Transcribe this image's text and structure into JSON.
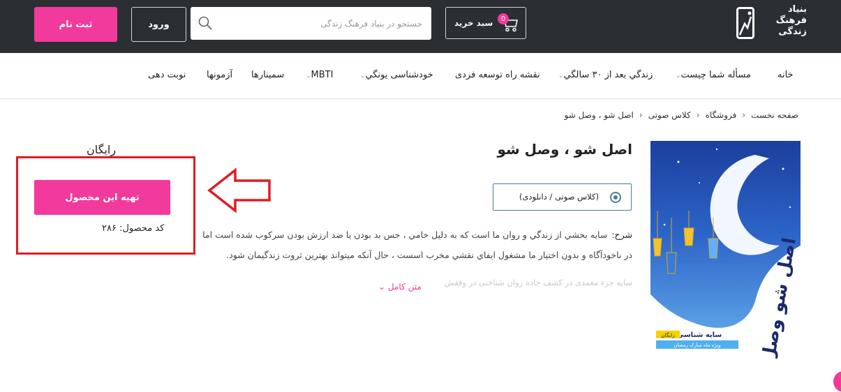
{
  "header": {
    "logo_lines": [
      "بنیاد",
      "فرهنگ",
      "زندگی"
    ],
    "signup_label": "ثبت نام",
    "login_label": "ورود",
    "search_placeholder": "جستجو در بنیاد فرهنگ زندگی",
    "cart_label": "سبد خرید",
    "cart_count": "0"
  },
  "nav": {
    "items": [
      {
        "label": "خانه"
      },
      {
        "label": "مسأله شما چیست",
        "dropdown": true
      },
      {
        "label": "زندگي بعد از ۳۰ سالگي",
        "dropdown": true
      },
      {
        "label": "نقشه راه توسعه فردی"
      },
      {
        "label": "خودشناسی يونگي",
        "dropdown": true
      },
      {
        "label": "MBTI",
        "dropdown": true
      },
      {
        "label": "سمینارها"
      },
      {
        "label": "آزمونها"
      },
      {
        "label": "نوبت دهی"
      }
    ]
  },
  "breadcrumb": [
    "صفحه نخست",
    "فروشگاه",
    "کلاس صوتی",
    "اصل شو ، وصل شو"
  ],
  "product": {
    "title": "اصل شو ، وصل شو",
    "price": "رایگان",
    "variant_label": "(کلاس صوتی / دانلودی)",
    "description_label": "شرح:",
    "description": "سايه بخشي از زندگي و روان ما است که به دليل خامي ، حس بد بودن يا ضد ارزش بودن سرکوب شده است اما در ناخودآگاه و بدون اختيار ما مشغول ايفاي نقشي مخرب اسست ، حال آنکه ميتواند بهترين ثروت زندگيمان شود.",
    "description_faded": "سایه جزء معمدی در کشف جاده روان شناختی در وقفش",
    "read_more": "متن کامل",
    "buy_label": "تهیه این محصول",
    "code_label": "کد محصول:",
    "code_value": "۲۸۶",
    "image": {
      "title_art": "اصل شو وصل شو",
      "tag": "سایه شناسی",
      "tag_badge": "رایگان",
      "subtag": "ویژه ماه مبارک رمضان"
    }
  },
  "colors": {
    "topbar": "#2b2f33",
    "accent": "#f23a9c",
    "highlight": "#e21b22",
    "variant_border": "#4a7f93"
  }
}
